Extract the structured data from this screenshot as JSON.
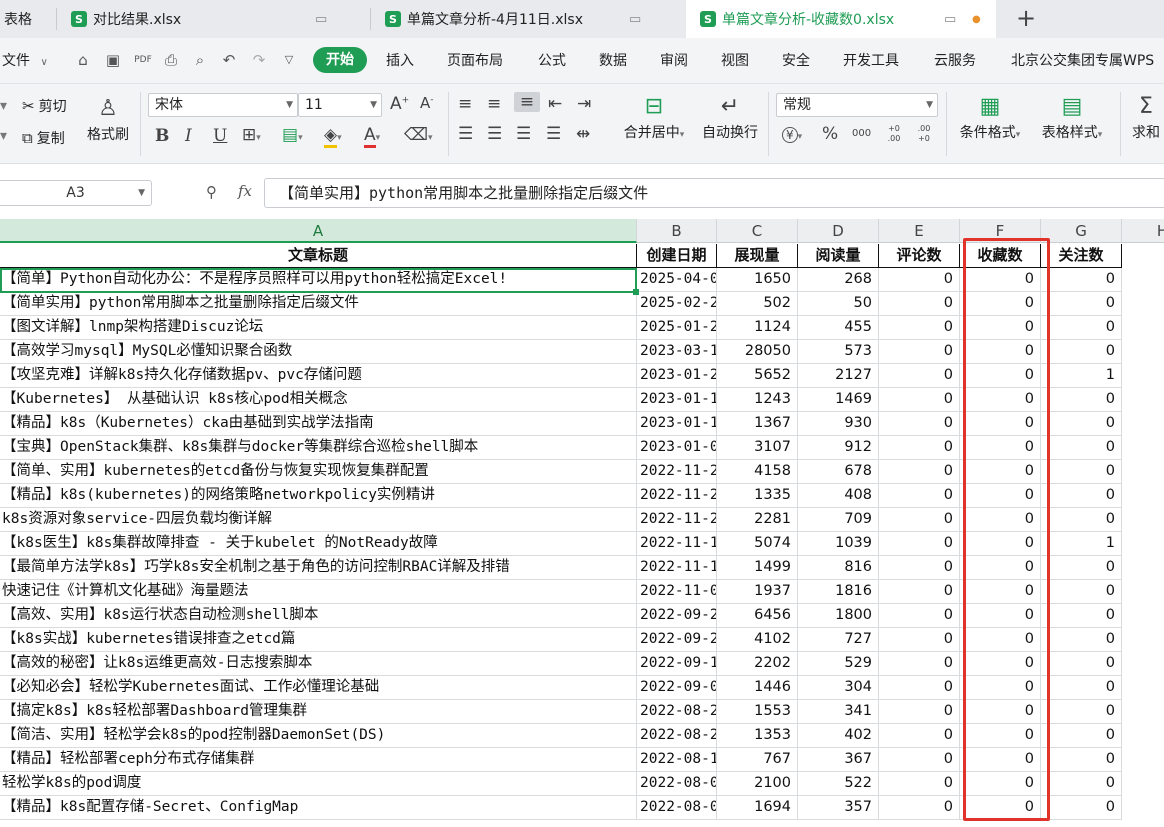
{
  "tabs": [
    {
      "label": "表格"
    },
    {
      "label": "对比结果.xlsx"
    },
    {
      "label": "单篇文章分析-4月11日.xlsx"
    },
    {
      "label": "单篇文章分析-收藏数0.xlsx",
      "active": true
    }
  ],
  "new_tab_symbol": "+",
  "menu": {
    "file": "文件",
    "start": "开始",
    "items": [
      "插入",
      "页面布局",
      "公式",
      "数据",
      "审阅",
      "视图",
      "安全",
      "开发工具",
      "云服务",
      "北京公交集团专属WPS"
    ]
  },
  "ribbon": {
    "cut": "剪切",
    "copy": "复制",
    "format_painter": "格式刷",
    "font_name": "宋体",
    "font_size": "11",
    "bold": "B",
    "italic": "I",
    "underline": "U",
    "font_color_letter": "A",
    "grow_font": "A",
    "shrink_font": "A",
    "merge_center": "合并居中",
    "wrap_text": "自动换行",
    "number_format": "常规",
    "currency": "¥",
    "percent": "%",
    "thousands": "000",
    "inc_decimal": "+0 .00",
    "dec_decimal": ".00 +0",
    "conditional_format": "条件格式",
    "table_style": "表格样式",
    "sum": "求和"
  },
  "formula_bar": {
    "cell_ref": "A3",
    "fx": "fx",
    "content": "【简单实用】python常用脚本之批量删除指定后缀文件"
  },
  "columns": [
    "A",
    "B",
    "C",
    "D",
    "E",
    "F",
    "G",
    "H"
  ],
  "header_row": [
    "文章标题",
    "创建日期",
    "展现量",
    "阅读量",
    "评论数",
    "收藏数",
    "关注数"
  ],
  "rows": [
    [
      "【简单】Python自动化办公：不是程序员照样可以用python轻松搞定Excel!",
      "2025-04-0",
      "1650",
      "268",
      "0",
      "0",
      "0"
    ],
    [
      "【简单实用】python常用脚本之批量删除指定后缀文件",
      "2025-02-2",
      "502",
      "50",
      "0",
      "0",
      "0"
    ],
    [
      "【图文详解】lnmp架构搭建Discuz论坛",
      "2025-01-2",
      "1124",
      "455",
      "0",
      "0",
      "0"
    ],
    [
      "【高效学习mysql】MySQL必懂知识聚合函数",
      "2023-03-1",
      "28050",
      "573",
      "0",
      "0",
      "0"
    ],
    [
      "【攻坚克难】详解k8s持久化存储数据pv、pvc存储问题",
      "2023-01-2",
      "5652",
      "2127",
      "0",
      "0",
      "1"
    ],
    [
      "【Kubernetes】 从基础认识 k8s核心pod相关概念",
      "2023-01-1",
      "1243",
      "1469",
      "0",
      "0",
      "0"
    ],
    [
      "【精品】k8s（Kubernetes）cka由基础到实战学法指南",
      "2023-01-1",
      "1367",
      "930",
      "0",
      "0",
      "0"
    ],
    [
      "【宝典】OpenStack集群、k8s集群与docker等集群综合巡检shell脚本",
      "2023-01-0",
      "3107",
      "912",
      "0",
      "0",
      "0"
    ],
    [
      "【简单、实用】kubernetes的etcd备份与恢复实现恢复集群配置",
      "2022-11-2",
      "4158",
      "678",
      "0",
      "0",
      "0"
    ],
    [
      "【精品】k8s(kubernetes)的网络策略networkpolicy实例精讲",
      "2022-11-2",
      "1335",
      "408",
      "0",
      "0",
      "0"
    ],
    [
      "k8s资源对象service-四层负载均衡详解",
      "2022-11-2",
      "2281",
      "709",
      "0",
      "0",
      "0"
    ],
    [
      "【k8s医生】k8s集群故障排查 - 关于kubelet 的NotReady故障",
      "2022-11-1",
      "5074",
      "1039",
      "0",
      "0",
      "1"
    ],
    [
      "【最简单方法学k8s】巧学k8s安全机制之基于角色的访问控制RBAC详解及排错",
      "2022-11-1",
      "1499",
      "816",
      "0",
      "0",
      "0"
    ],
    [
      "快速记住《计算机文化基础》海量题法",
      "2022-11-0",
      "1937",
      "1816",
      "0",
      "0",
      "0"
    ],
    [
      "【高效、实用】k8s运行状态自动检测shell脚本",
      "2022-09-2",
      "6456",
      "1800",
      "0",
      "0",
      "0"
    ],
    [
      "【k8s实战】kubernetes错误排查之etcd篇",
      "2022-09-2",
      "4102",
      "727",
      "0",
      "0",
      "0"
    ],
    [
      "【高效的秘密】让k8s运维更高效-日志搜索脚本",
      "2022-09-1",
      "2202",
      "529",
      "0",
      "0",
      "0"
    ],
    [
      "【必知必会】轻松学Kubernetes面试、工作必懂理论基础",
      "2022-09-0",
      "1446",
      "304",
      "0",
      "0",
      "0"
    ],
    [
      "【搞定k8s】k8s轻松部署Dashboard管理集群",
      "2022-08-2",
      "1553",
      "341",
      "0",
      "0",
      "0"
    ],
    [
      "【简洁、实用】轻松学会k8s的pod控制器DaemonSet(DS)",
      "2022-08-2",
      "1353",
      "402",
      "0",
      "0",
      "0"
    ],
    [
      "【精品】轻松部署ceph分布式存储集群",
      "2022-08-1",
      "767",
      "367",
      "0",
      "0",
      "0"
    ],
    [
      "轻松学k8s的pod调度",
      "2022-08-0",
      "2100",
      "522",
      "0",
      "0",
      "0"
    ],
    [
      "【精品】k8s配置存储-Secret、ConfigMap",
      "2022-08-0",
      "1694",
      "357",
      "0",
      "0",
      "0"
    ]
  ],
  "colors": {
    "accent": "#1f9d55",
    "highlight_box": "#e0342b"
  }
}
